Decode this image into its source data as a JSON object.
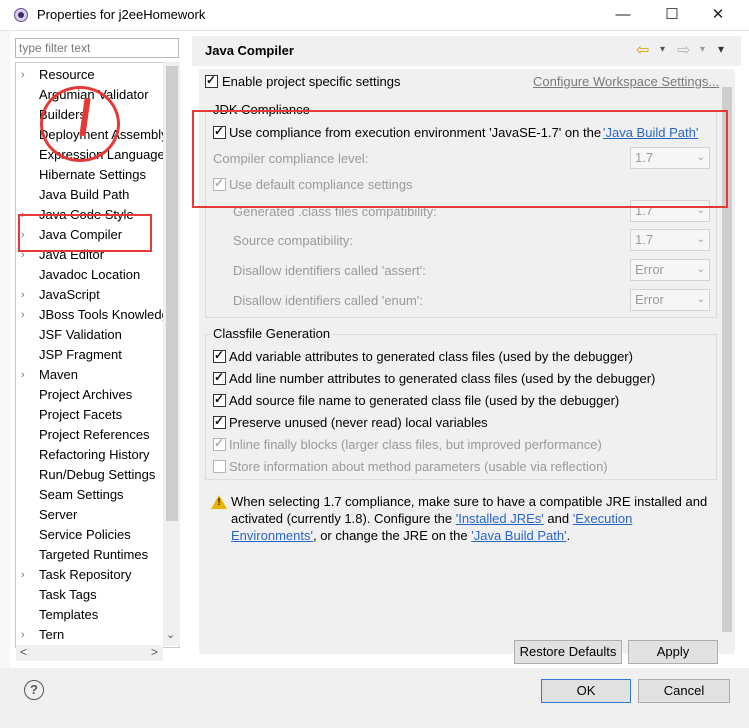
{
  "window": {
    "title": "Properties for j2eeHomework",
    "minimize": "—",
    "maximize": "☐",
    "close": "✕"
  },
  "filter": {
    "placeholder": "type filter text"
  },
  "tree": {
    "items": [
      {
        "label": "Resource",
        "expandable": true
      },
      {
        "label": "Argumian Validator",
        "expandable": false
      },
      {
        "label": "Builders",
        "expandable": false
      },
      {
        "label": "Deployment Assembly",
        "expandable": false
      },
      {
        "label": "Expression Language",
        "expandable": false
      },
      {
        "label": "Hibernate Settings",
        "expandable": false
      },
      {
        "label": "Java Build Path",
        "expandable": false
      },
      {
        "label": "Java Code Style",
        "expandable": true
      },
      {
        "label": "Java Compiler",
        "expandable": true,
        "selected": true
      },
      {
        "label": "Java Editor",
        "expandable": true
      },
      {
        "label": "Javadoc Location",
        "expandable": false
      },
      {
        "label": "JavaScript",
        "expandable": true
      },
      {
        "label": "JBoss Tools Knowledge",
        "expandable": true
      },
      {
        "label": "JSF Validation",
        "expandable": false
      },
      {
        "label": "JSP Fragment",
        "expandable": false
      },
      {
        "label": "Maven",
        "expandable": true
      },
      {
        "label": "Project Archives",
        "expandable": false
      },
      {
        "label": "Project Facets",
        "expandable": false
      },
      {
        "label": "Project References",
        "expandable": false
      },
      {
        "label": "Refactoring History",
        "expandable": false
      },
      {
        "label": "Run/Debug Settings",
        "expandable": false
      },
      {
        "label": "Seam Settings",
        "expandable": false
      },
      {
        "label": "Server",
        "expandable": false
      },
      {
        "label": "Service Policies",
        "expandable": false
      },
      {
        "label": "Targeted Runtimes",
        "expandable": false
      },
      {
        "label": "Task Repository",
        "expandable": true
      },
      {
        "label": "Task Tags",
        "expandable": false
      },
      {
        "label": "Templates",
        "expandable": false
      },
      {
        "label": "Tern",
        "expandable": true
      }
    ],
    "scroll_left": "<",
    "scroll_right": ">",
    "scroll_down": "⌄"
  },
  "page": {
    "title": "Java Compiler",
    "nav_back": "⇦",
    "nav_forward": "⇨",
    "menu": "▾",
    "enable_specific": "Enable project specific settings",
    "configure_link": "Configure Workspace Settings...",
    "jdk_group": "JDK Compliance",
    "use_compliance_prefix": "Use compliance from execution environment 'JavaSE-1.7' on the",
    "java_build_path_link": "'Java Build Path'",
    "compliance_level_label": "Compiler compliance level:",
    "compliance_level_value": "1.7",
    "use_default": "Use default compliance settings",
    "generated_label": "Generated .class files compatibility:",
    "generated_value": "1.7",
    "source_label": "Source compatibility:",
    "source_value": "1.7",
    "assert_label": "Disallow identifiers called 'assert':",
    "assert_value": "Error",
    "enum_label": "Disallow identifiers called 'enum':",
    "enum_value": "Error",
    "classfile_group": "Classfile Generation",
    "opt_variable": "Add variable attributes to generated class files (used by the debugger)",
    "opt_line": "Add line number attributes to generated class files (used by the debugger)",
    "opt_source": "Add source file name to generated class file (used by the debugger)",
    "opt_preserve": "Preserve unused (never read) local variables",
    "opt_inline": "Inline finally blocks (larger class files, but improved performance)",
    "opt_store": "Store information about method parameters (usable via reflection)",
    "warn_line1": "When selecting 1.7 compliance, make sure to have a compatible JRE installed and",
    "warn_line2_prefix": "activated (currently 1.8). Configure the",
    "installed_jres_link": "'Installed JREs'",
    "warn_and": "and",
    "execution_link_part1": "'Execution",
    "execution_link_part2": "Environments'",
    "warn_line3_mid": ", or change the JRE on the",
    "java_build_path_link2": "'Java Build Path'",
    "warn_end": ".",
    "restore_defaults": "Restore Defaults",
    "apply": "Apply"
  },
  "footer": {
    "help": "?",
    "ok": "OK",
    "cancel": "Cancel"
  },
  "annotations": {
    "color": "#e53935"
  }
}
